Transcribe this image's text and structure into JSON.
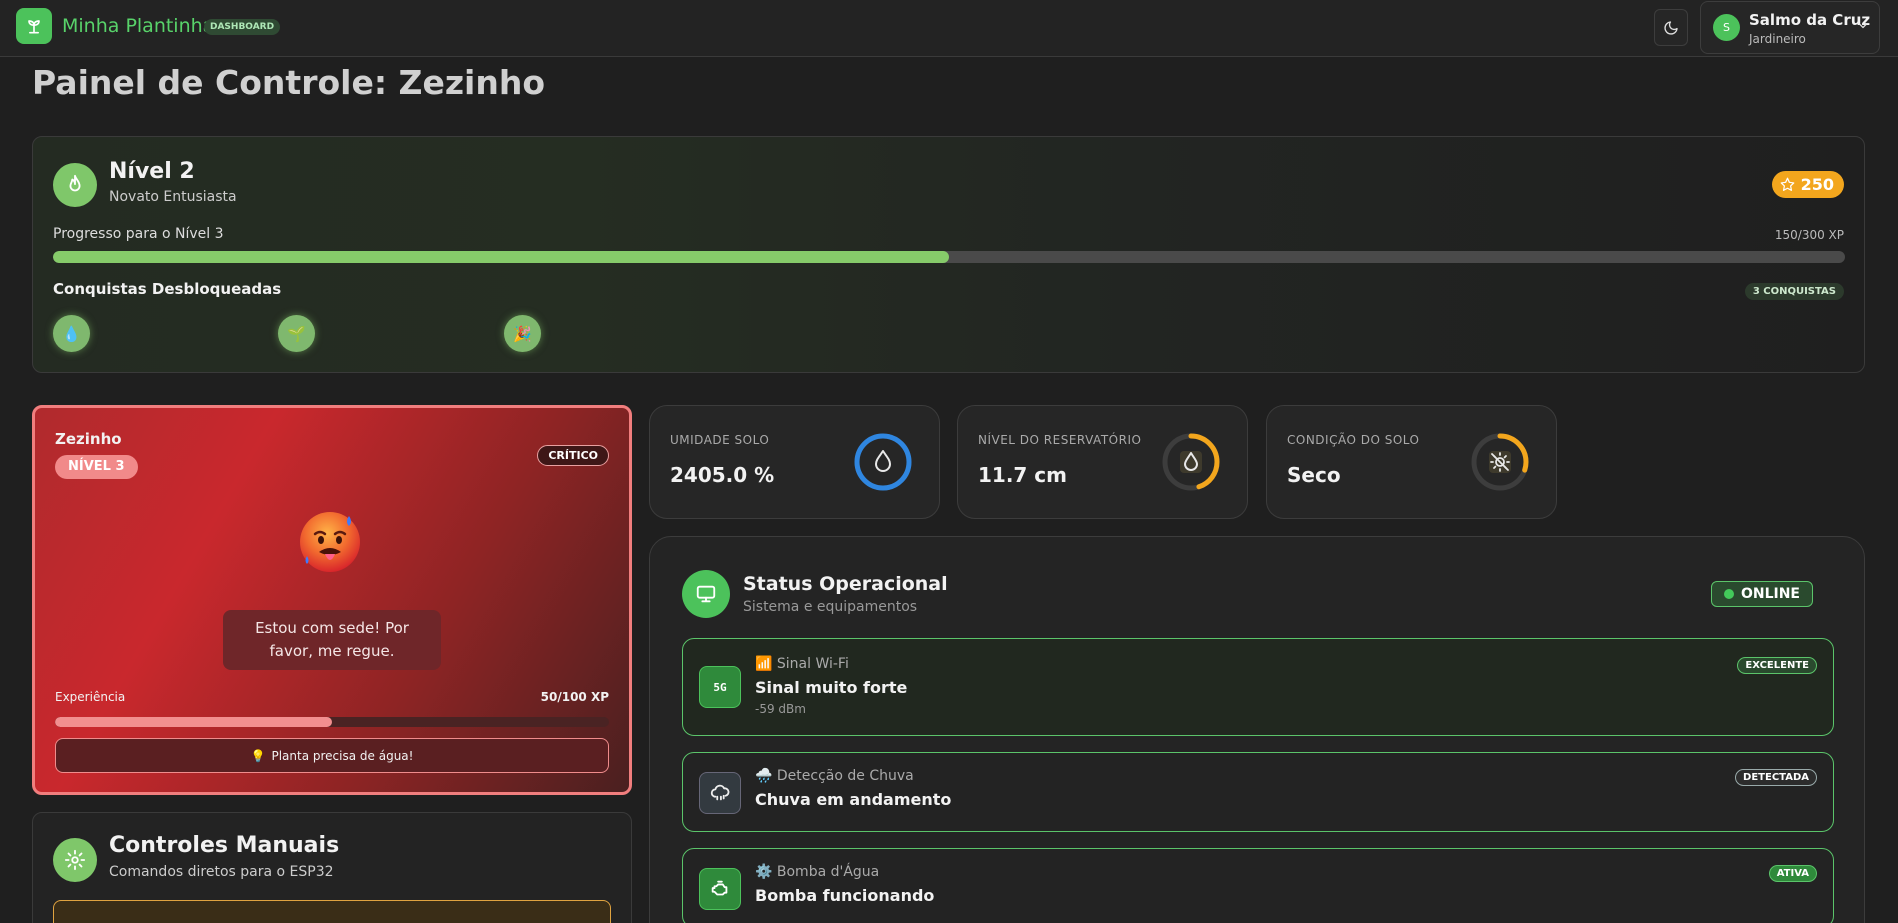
{
  "header": {
    "brand": "Minha Plantinha",
    "badge": "DASHBOARD",
    "user": {
      "initial": "S",
      "name": "Salmo da Cruz",
      "role": "Jardineiro"
    }
  },
  "page_title": "Painel de Controle: Zezinho",
  "level": {
    "title": "Nível 2",
    "subtitle": "Novato Entusiasta",
    "points": "250",
    "progress_label": "Progresso para o Nível 3",
    "progress_xp": "150/300 XP",
    "progress_fraction": 0.5,
    "achievements_title": "Conquistas Desbloqueadas",
    "achievements_count": "3 CONQUISTAS",
    "achievements": [
      "💧",
      "🌱",
      "🎉"
    ]
  },
  "plant": {
    "name": "Zezinho",
    "level": "NÍVEL 3",
    "status": "CRÍTICO",
    "message": "Estou com sede! Por favor, me regue.",
    "exp_label": "Experiência",
    "exp_value": "50/100 XP",
    "exp_fraction": 0.5,
    "tip": "Planta precisa de água!",
    "tip_icon": "💡"
  },
  "controls": {
    "title": "Controles Manuais",
    "subtitle": "Comandos diretos para o ESP32"
  },
  "metrics": [
    {
      "label": "UMIDADE SOLO",
      "value": "2405.0 %",
      "icon": "drop-icon",
      "color": "#2f86e0",
      "fraction": 1.0
    },
    {
      "label": "NÍVEL DO RESERVATÓRIO",
      "value": "11.7 cm",
      "icon": "drop-icon",
      "color": "#f3a61d",
      "fraction": 0.45
    },
    {
      "label": "CONDIÇÃO DO SOLO",
      "value": "Seco",
      "icon": "sun-off-icon",
      "color": "#f3a61d",
      "fraction": 0.3
    }
  ],
  "status": {
    "title": "Status Operacional",
    "subtitle": "Sistema e equipamentos",
    "online": "ONLINE",
    "wifi": {
      "kicker": "📶 Sinal Wi-Fi",
      "title": "Sinal muito forte",
      "meta": "-59 dBm",
      "badge": "EXCELENTE",
      "icon_text": "5G"
    },
    "rain": {
      "kicker": "🌧️ Detecção de Chuva",
      "title": "Chuva em andamento",
      "badge": "DETECTADA"
    },
    "pump": {
      "kicker": "⚙️ Bomba d'Água",
      "title": "Bomba funcionando",
      "badge": "ATIVA"
    }
  }
}
